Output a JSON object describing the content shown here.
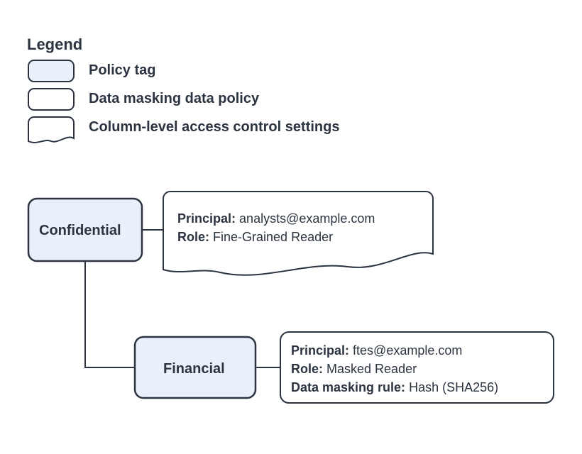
{
  "legend": {
    "title": "Legend",
    "policy_tag": "Policy tag",
    "data_policy": "Data masking data policy",
    "clacs": "Column-level access control settings"
  },
  "tags": {
    "confidential": "Confidential",
    "financial": "Financial"
  },
  "clacs_card": {
    "principal_label": "Principal:",
    "principal_value": "analysts@example.com",
    "role_label": "Role:",
    "role_value": "Fine-Grained Reader"
  },
  "policy_card": {
    "principal_label": "Principal:",
    "principal_value": "ftes@example.com",
    "role_label": "Role:",
    "role_value": "Masked Reader",
    "rule_label": "Data masking rule:",
    "rule_value": "Hash (SHA256)"
  }
}
